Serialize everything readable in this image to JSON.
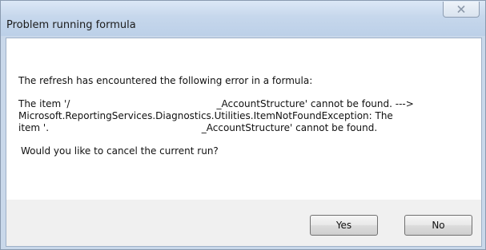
{
  "dialog": {
    "title": "Problem running formula",
    "close_icon": "close-icon",
    "message_line_1": "The refresh has encountered the following error in a formula:",
    "message_line_2": "The item '/                                                _AccountStructure' cannot be found. --->",
    "message_line_3": "Microsoft.ReportingServices.Diagnostics.Utilities.ItemNotFoundException: The",
    "message_line_4": "item '.                                                  _AccountStructure' cannot be found.",
    "question": "Would you like to cancel the current run?",
    "yes_label": "Yes",
    "no_label": "No"
  }
}
